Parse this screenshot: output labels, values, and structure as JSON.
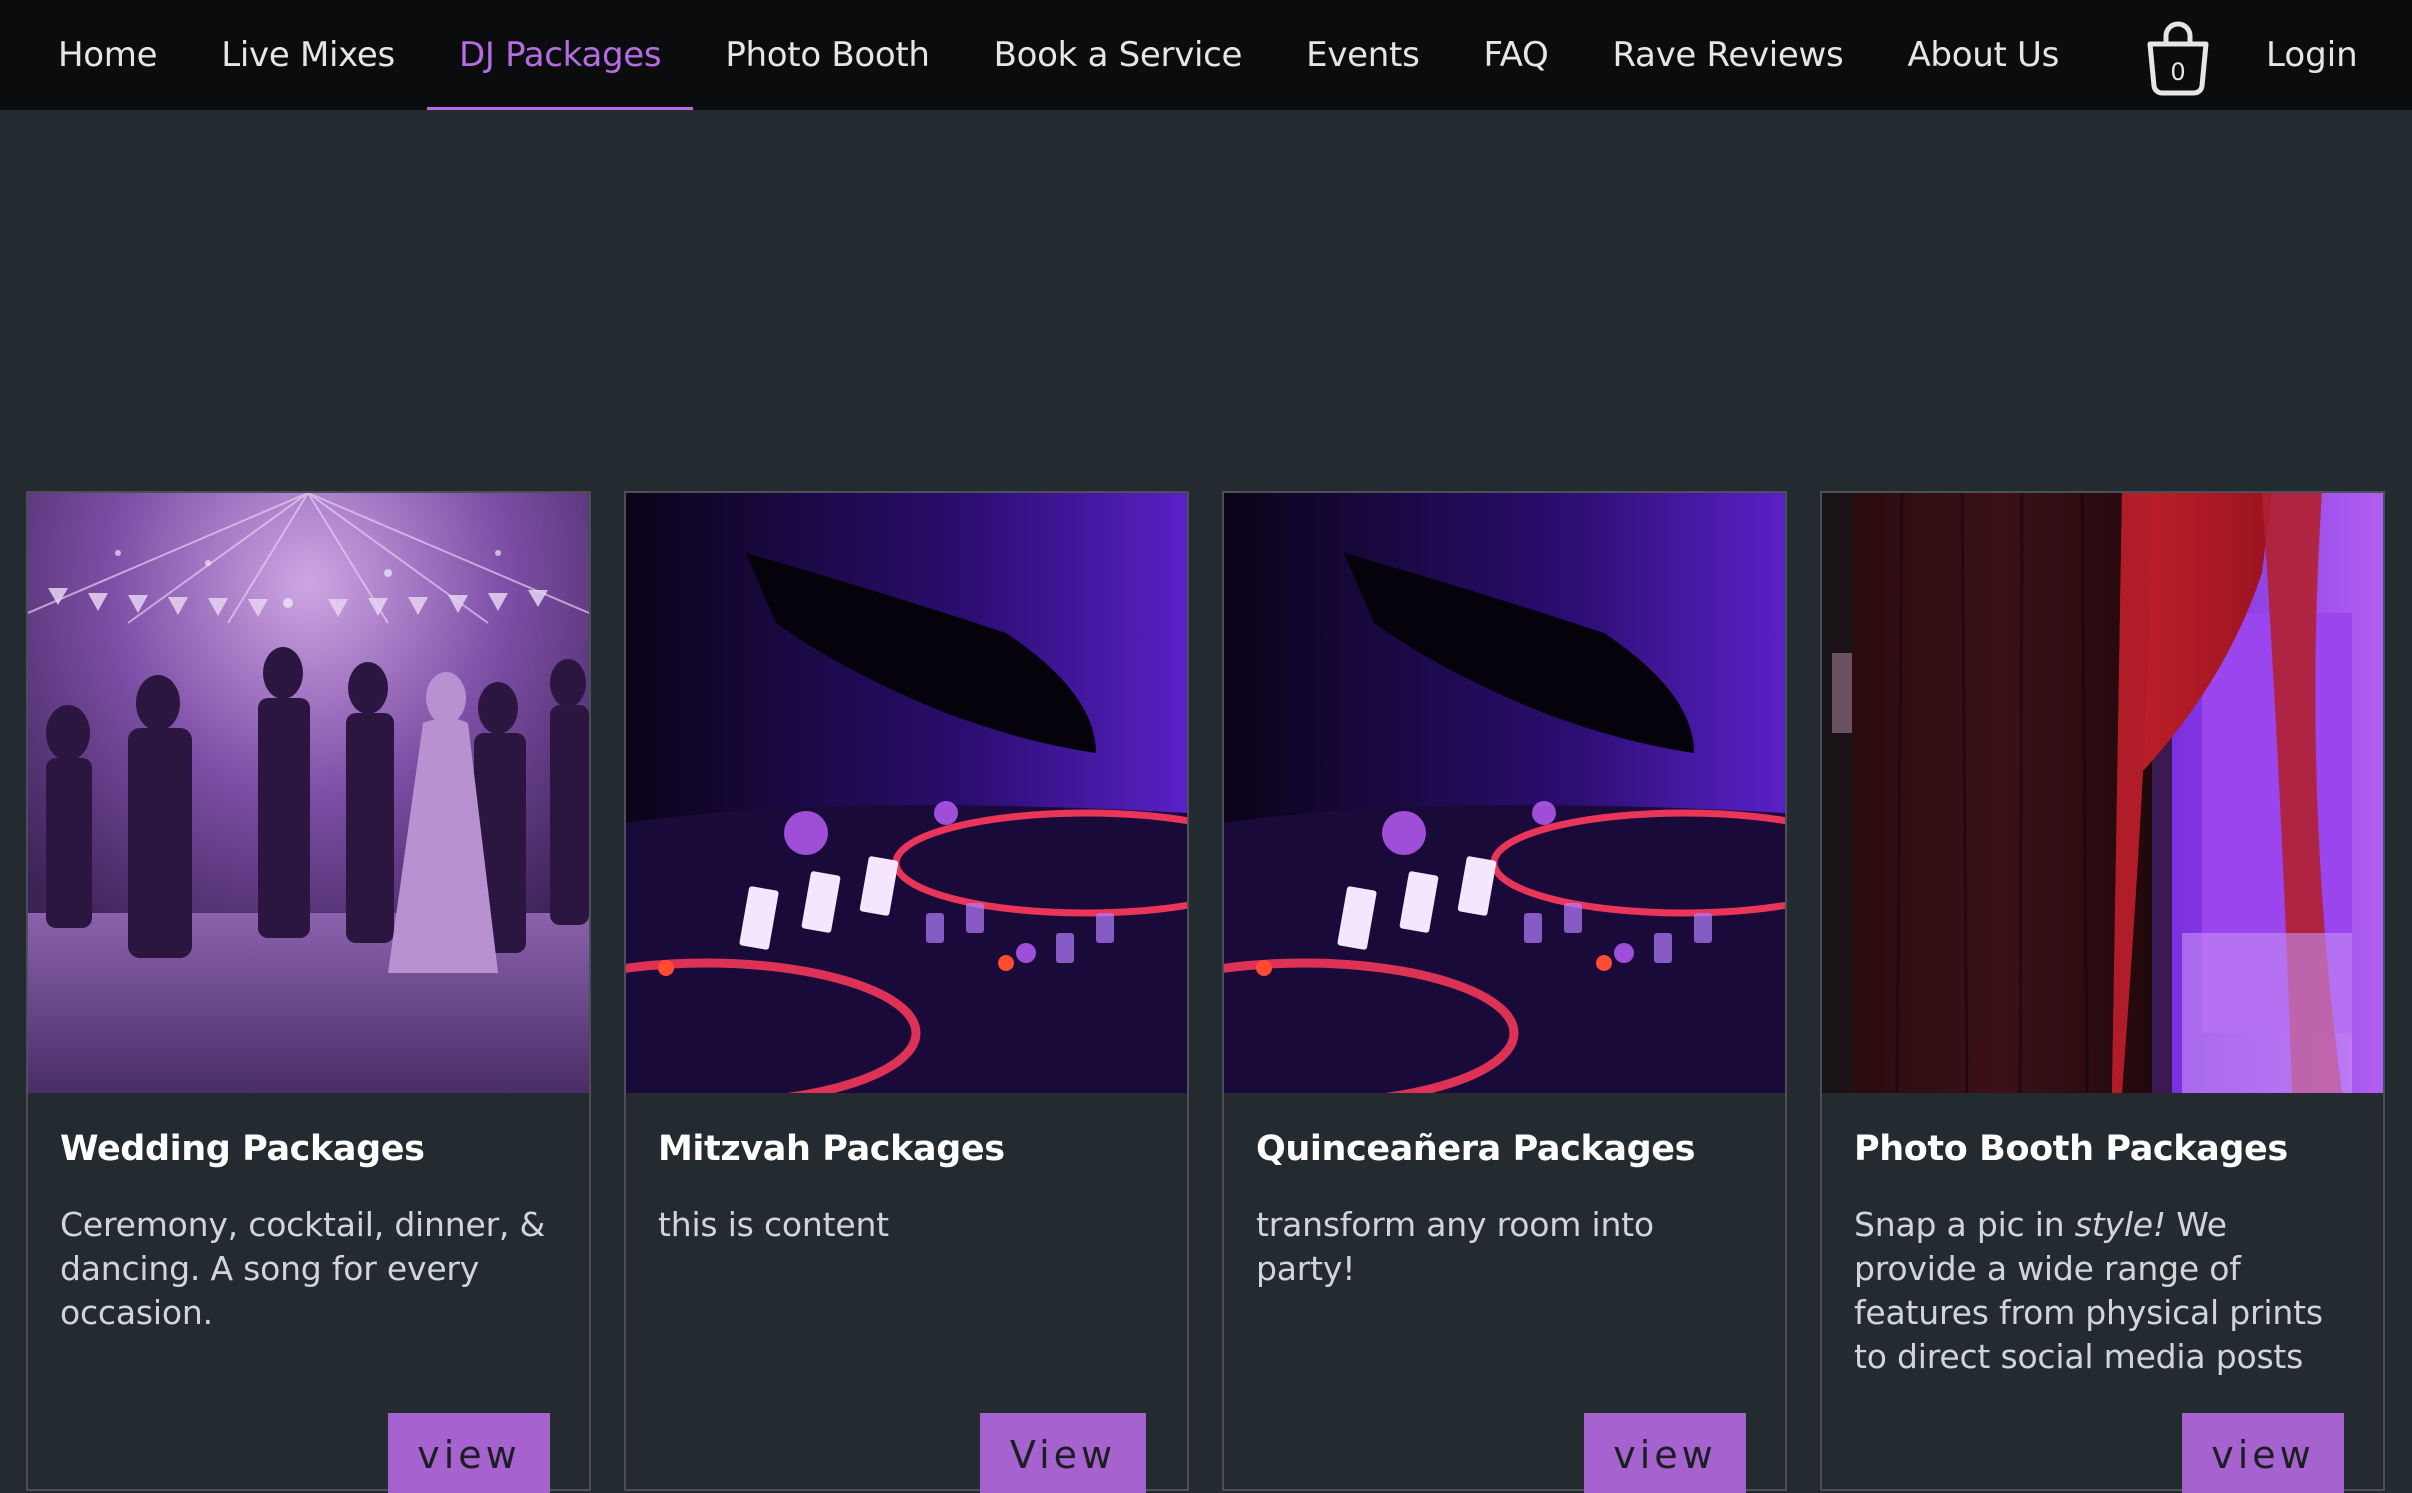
{
  "nav": {
    "items": [
      {
        "label": "Home",
        "active": false
      },
      {
        "label": "Live Mixes",
        "active": false
      },
      {
        "label": "DJ Packages",
        "active": true
      },
      {
        "label": "Photo Booth",
        "active": false
      },
      {
        "label": "Book a Service",
        "active": false
      },
      {
        "label": "Events",
        "active": false
      },
      {
        "label": "FAQ",
        "active": false
      },
      {
        "label": "Rave Reviews",
        "active": false
      },
      {
        "label": "About Us",
        "active": false
      }
    ],
    "cart_count": "0",
    "cart_icon": "shopping-bag-icon",
    "login_label": "Login"
  },
  "colors": {
    "accent": "#b56ce0",
    "button": "#a662cf",
    "nav_bg": "#0b0c0d",
    "page_bg": "#232a30"
  },
  "cards": [
    {
      "title": "Wedding Packages",
      "description": "Ceremony, cocktail, dinner, & dancing. A song for every occasion.",
      "button": "view",
      "image": "wedding-dance-photo"
    },
    {
      "title": "Mitzvah Packages",
      "description": "this is content",
      "button": "View",
      "image": "dj-mixer-photo"
    },
    {
      "title": "Quinceañera Packages",
      "description": "transform any room into party!",
      "button": "view",
      "image": "dj-mixer-photo"
    },
    {
      "title": "Photo Booth Packages",
      "description_pre": "Snap a pic in ",
      "description_em": "style!",
      "description_post": " We provide a wide range of features from physical prints to direct social media posts",
      "button": "view",
      "image": "photo-booth-curtain-photo"
    }
  ]
}
